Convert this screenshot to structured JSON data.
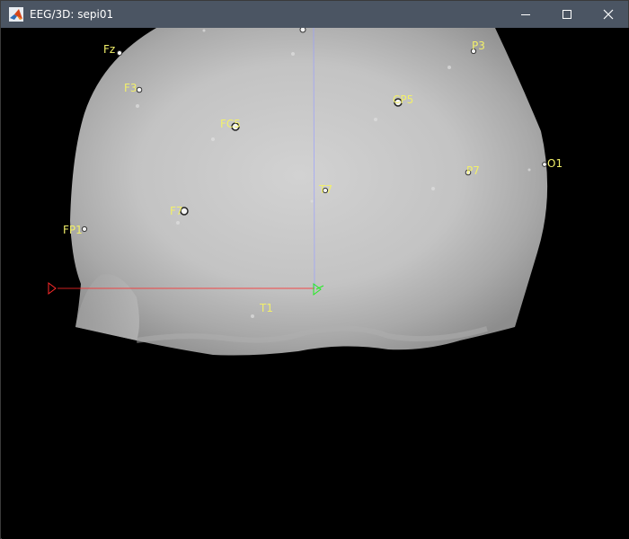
{
  "window": {
    "title": "EEG/3D: sepi01",
    "app_icon": "matlab-icon",
    "controls": {
      "minimize_icon": "minimize-icon",
      "maximize_icon": "maximize-icon",
      "close_icon": "close-icon"
    }
  },
  "scene": {
    "background_color": "#000000",
    "surface_color": "#c8c8c8",
    "label_color": "#f2f06a",
    "axis_x_color": "#ff2a2a",
    "axis_y_color": "#22ee22",
    "axis_z_color": "#9aa0ff",
    "electrodes": [
      {
        "id": "fz",
        "label": "Fz"
      },
      {
        "id": "p3",
        "label": "P3"
      },
      {
        "id": "f3",
        "label": "F3"
      },
      {
        "id": "cp5",
        "label": "CP5"
      },
      {
        "id": "fc5",
        "label": "FC5"
      },
      {
        "id": "o1",
        "label": "O1"
      },
      {
        "id": "p7",
        "label": "P7"
      },
      {
        "id": "t7",
        "label": "T7"
      },
      {
        "id": "f7",
        "label": "F7"
      },
      {
        "id": "fp1",
        "label": "FP1"
      },
      {
        "id": "t1",
        "label": "T1"
      }
    ]
  }
}
